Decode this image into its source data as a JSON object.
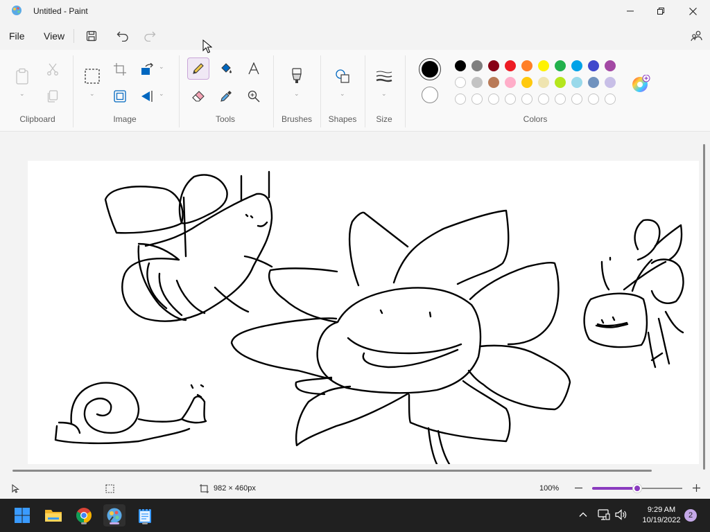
{
  "window": {
    "title": "Untitled - Paint"
  },
  "menu": {
    "file": "File",
    "view": "View"
  },
  "ribbon": {
    "groups": {
      "clipboard": "Clipboard",
      "image": "Image",
      "tools": "Tools",
      "brushes": "Brushes",
      "shapes": "Shapes",
      "size": "Size",
      "colors": "Colors"
    },
    "active_tool": "pencil",
    "primary_color": "#000000",
    "secondary_color": "#ffffff",
    "palette": [
      [
        "#000000",
        "#7f7f7f",
        "#880015",
        "#ed1c24",
        "#ff7f27",
        "#fff200",
        "#22b14c",
        "#00a2e8",
        "#3f48cc",
        "#a349a4"
      ],
      [
        "#ffffff",
        "#c3c3c3",
        "#b97a57",
        "#ffaec9",
        "#ffc90e",
        "#efe4b0",
        "#b5e61d",
        "#99d9ea",
        "#7092be",
        "#c8bfe7"
      ],
      [
        "",
        "",
        "",
        "",
        "",
        "",
        "",
        "",
        "",
        ""
      ]
    ]
  },
  "status": {
    "canvas_size": "982 × 460px",
    "zoom": "100%",
    "zoom_level": 0.5
  },
  "taskbar": {
    "time": "9:29 AM",
    "date": "10/19/2022",
    "notifications": "2"
  }
}
